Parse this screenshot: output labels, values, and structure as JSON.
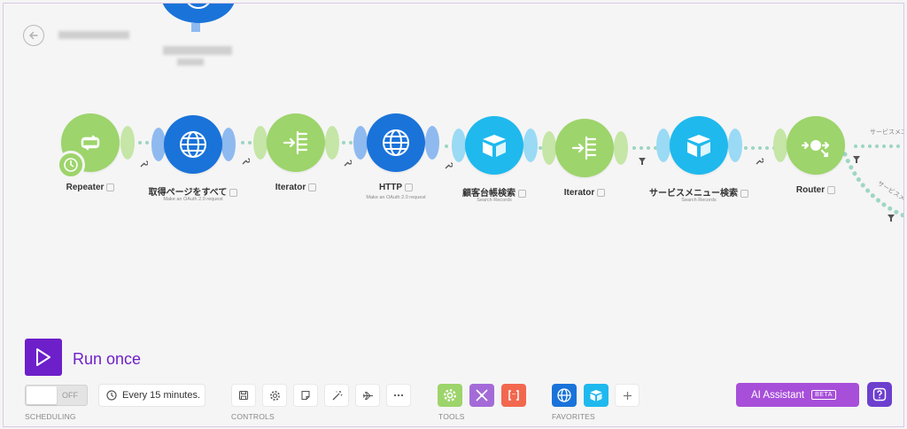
{
  "modules": [
    {
      "label": "Repeater",
      "subtitle": ""
    },
    {
      "label": "取得ページをすべて",
      "subtitle": "Make an OAuth 2.0 request"
    },
    {
      "label": "Iterator",
      "subtitle": ""
    },
    {
      "label": "HTTP",
      "subtitle": "Make an OAuth 2.0 request"
    },
    {
      "label": "顧客台帳検索",
      "subtitle": "Search Records"
    },
    {
      "label": "Iterator",
      "subtitle": ""
    },
    {
      "label": "サービスメニュー検索",
      "subtitle": "Search Records"
    },
    {
      "label": "Router",
      "subtitle": ""
    }
  ],
  "routes": [
    "サービスメニ",
    "サービスメニ"
  ],
  "run": {
    "label": "Run once"
  },
  "scheduling": {
    "toggle_label": "OFF",
    "interval": "Every 15 minutes.",
    "section_label": "SCHEDULING"
  },
  "controls": {
    "section_label": "CONTROLS"
  },
  "tools": {
    "section_label": "TOOLS"
  },
  "favorites": {
    "section_label": "FAVORITES"
  },
  "ai": {
    "label": "AI Assistant",
    "badge": "BETA"
  },
  "colors": {
    "accent": "#6d1fc9",
    "green": "#9dd46b",
    "blue": "#1a73d9",
    "cyan": "#1fb9ee",
    "ai": "#a74fd9"
  }
}
